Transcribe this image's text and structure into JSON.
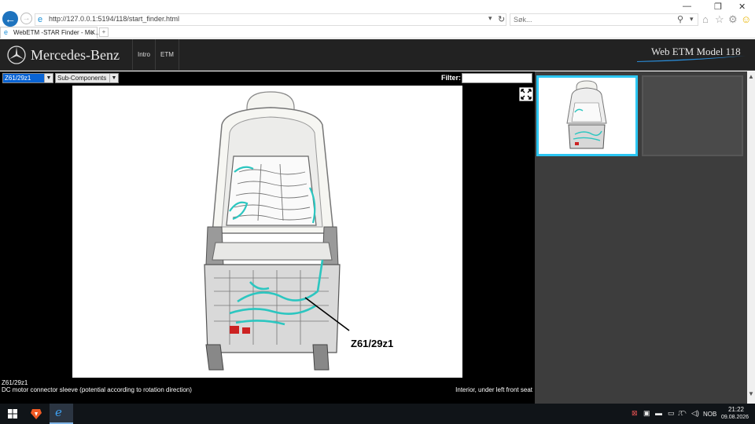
{
  "browser": {
    "url": "http://127.0.0.1:5194/118/start_finder.html",
    "search_placeholder": "Søk...",
    "tab_title": "WebETM -STAR Finder - Mo...",
    "tab_close": "✕",
    "new_tab": "+",
    "window": {
      "minimize": "—",
      "restore": "❐",
      "close": "✕"
    }
  },
  "app": {
    "brand": "Mercedes-Benz",
    "nav": [
      "Intro",
      "ETM"
    ],
    "model_title": "Web ETM Model 118"
  },
  "toolbar": {
    "component_value": "Z61/29z1",
    "subcomponents_value": "Sub-Components",
    "filter_label": "Filter:",
    "filter_value": ""
  },
  "diagram": {
    "callout_label": "Z61/29z1",
    "accent_color": "#2cc6c0"
  },
  "info": {
    "component_id": "Z61/29z1",
    "description": "DC motor connector sleeve (potential according to rotation direction)",
    "location": "Interior, under left front seat"
  },
  "thumbnails": {
    "selected_border_color": "#2cc6f2"
  },
  "taskbar": {
    "language": "NOB",
    "time": "21:22",
    "date": "09.08.2026"
  }
}
